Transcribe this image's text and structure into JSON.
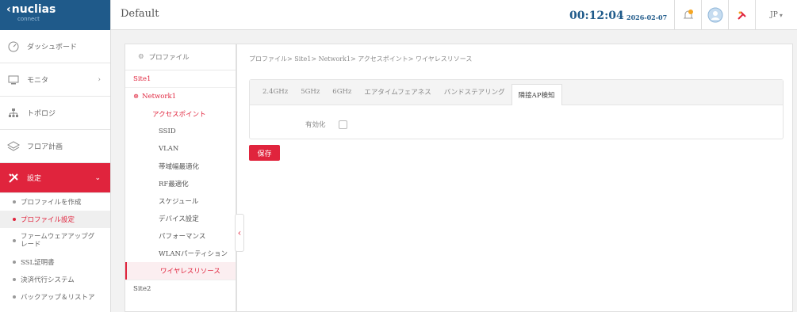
{
  "brand": {
    "name": "nuclias",
    "sub": "connect"
  },
  "topbar": {
    "title": "Default",
    "time": "00:12:04",
    "date": "2026-02-07",
    "user": "JP"
  },
  "sidebar": {
    "items": [
      {
        "label": "ダッシュボード",
        "icon": "dashboard-icon"
      },
      {
        "label": "モニタ",
        "icon": "monitor-icon"
      },
      {
        "label": "トポロジ",
        "icon": "topology-icon"
      },
      {
        "label": "フロア計画",
        "icon": "floor-plan-icon"
      }
    ],
    "settings_label": "設定",
    "sub_items": [
      "プロファイルを作成",
      "プロファイル設定",
      "ファームウェアアップグレード",
      "SSL証明書",
      "決済代行システム",
      "バックアップ＆リストア"
    ]
  },
  "tree": {
    "header": "プロファイル",
    "site1": "Site1",
    "network": "Network1",
    "access_point": "アクセスポイント",
    "leaves": [
      "SSID",
      "VLAN",
      "帯域幅最適化",
      "RF最適化",
      "スケジュール",
      "デバイス設定",
      "パフォーマンス",
      "WLANパーティション",
      "ワイヤレスリソース"
    ],
    "site2": "Site2"
  },
  "breadcrumb": "プロファイル> Site1> Network1> アクセスポイント> ワイヤレスリソース",
  "tabs": [
    "2.4GHz",
    "5GHz",
    "6GHz",
    "エアタイムフェアネス",
    "バンドステアリング",
    "隣接AP検知"
  ],
  "option_label": "有効化",
  "save_label": "保存",
  "colors": {
    "accent": "#e0243d",
    "brand": "#1f5a8a"
  }
}
